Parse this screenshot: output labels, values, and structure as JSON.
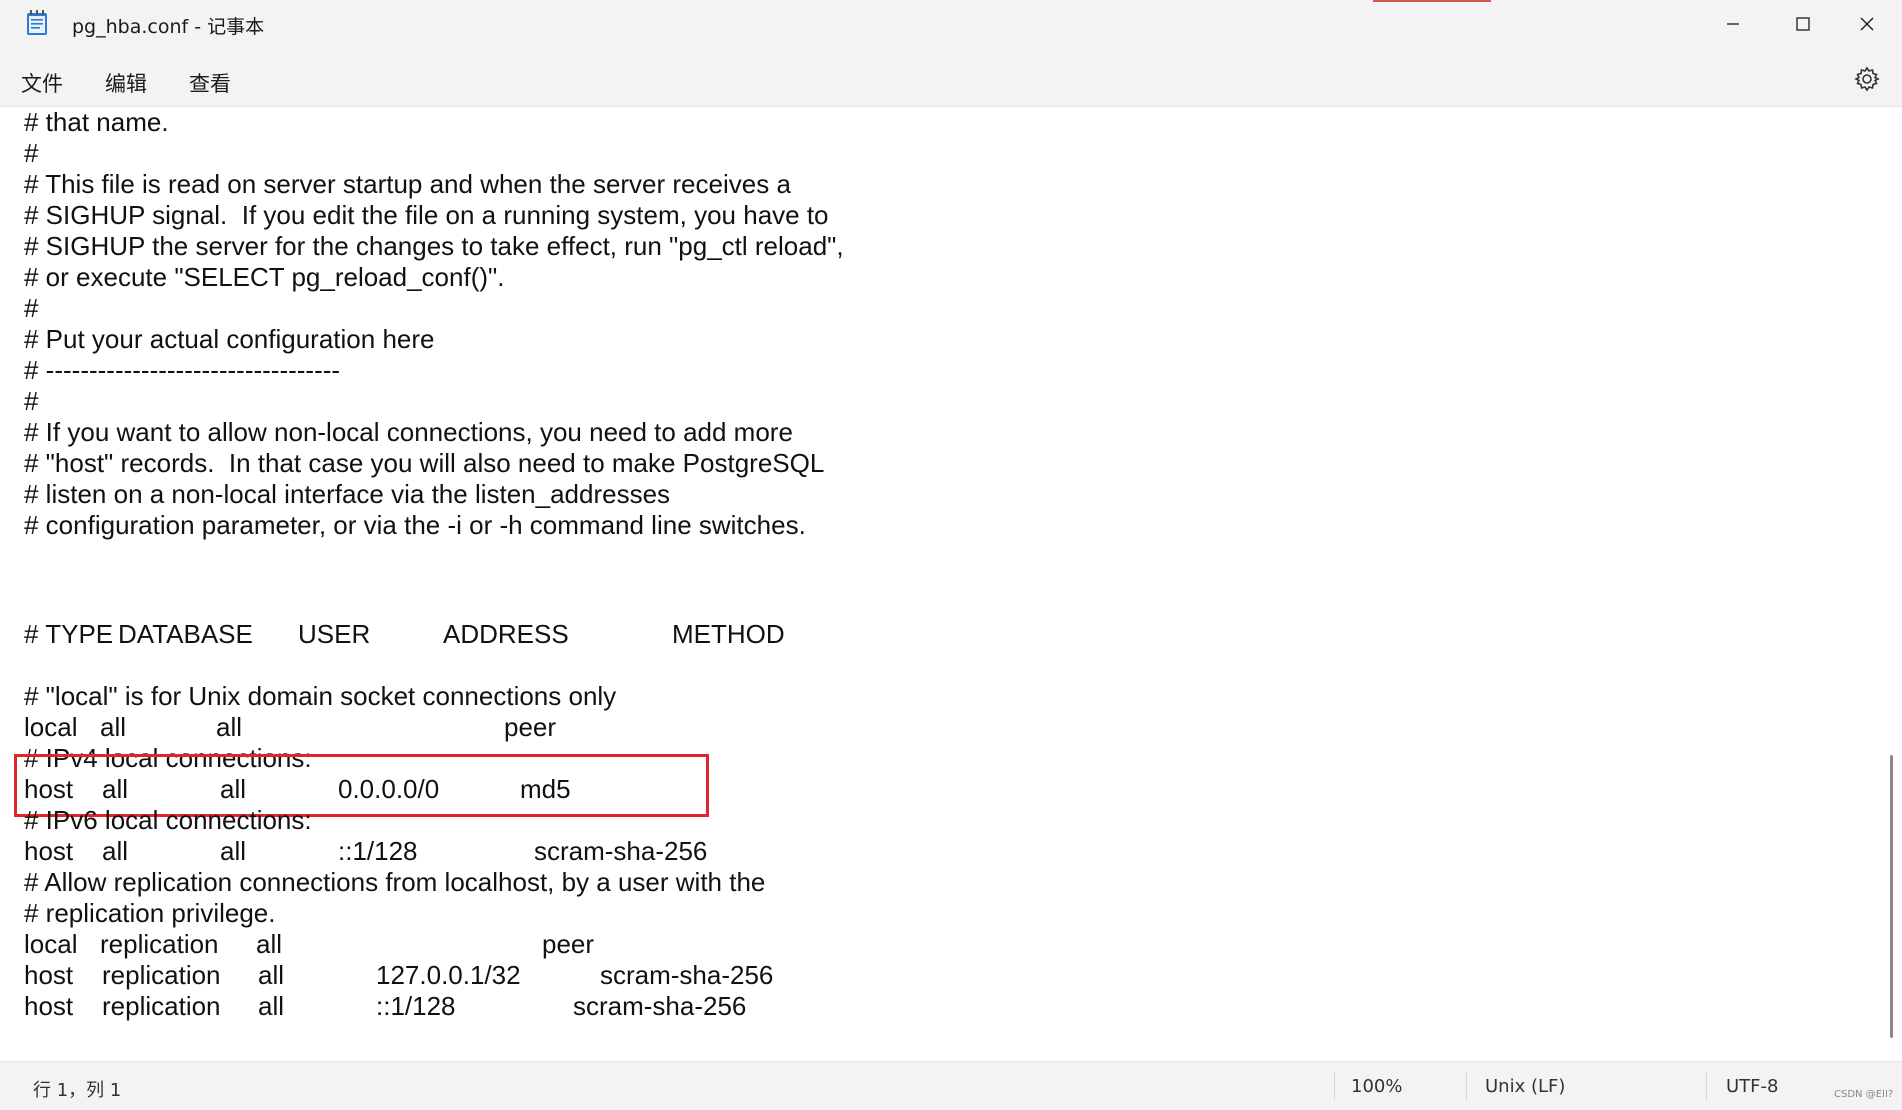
{
  "window": {
    "title": "pg_hba.conf - 记事本",
    "app_icon": "notepad-icon",
    "controls": [
      "minimize-icon",
      "maximize-icon",
      "close-icon"
    ]
  },
  "menu": {
    "file": "文件",
    "edit": "编辑",
    "view": "查看",
    "settings_icon": "gear-icon"
  },
  "editor": {
    "lines": [
      "# that name.",
      "#",
      "# This file is read on server startup and when the server receives a",
      "# SIGHUP signal.  If you edit the file on a running system, you have to",
      "# SIGHUP the server for the changes to take effect, run \"pg_ctl reload\",",
      "# or execute \"SELECT pg_reload_conf()\".",
      "#",
      "# Put your actual configuration here",
      "# ----------------------------------",
      "#",
      "# If you want to allow non-local connections, you need to add more",
      "# \"host\" records.  In that case you will also need to make PostgreSQL",
      "# listen on a non-local interface via the listen_addresses",
      "# configuration parameter, or via the -i or -h command line switches."
    ],
    "header": {
      "prefix": "# TYPE",
      "database": "DATABASE",
      "user": "USER",
      "address": "ADDRESS",
      "method": "METHOD"
    },
    "local_comment": "# \"local\" is for Unix domain socket connections only",
    "ipv4_comment": "# IPv4 local connections:",
    "ipv6_comment": "# IPv6 local connections:",
    "replication_comment_1": "# Allow replication connections from localhost, by a user with the",
    "replication_comment_2": "# replication privilege.",
    "rows": [
      {
        "type": "local",
        "database": "all",
        "user": "all",
        "address": "",
        "method": "peer"
      },
      {
        "type": "host",
        "database": "all",
        "user": "all",
        "address": "0.0.0.0/0",
        "method": "md5"
      },
      {
        "type": "host",
        "database": "all",
        "user": "all",
        "address": "::1/128",
        "method": "scram-sha-256"
      },
      {
        "type": "local",
        "database": "replication",
        "user": "all",
        "address": "",
        "method": "peer"
      },
      {
        "type": "host",
        "database": "replication",
        "user": "all",
        "address": "127.0.0.1/32",
        "method": "scram-sha-256"
      },
      {
        "type": "host",
        "database": "replication",
        "user": "all",
        "address": "::1/128",
        "method": "scram-sha-256"
      }
    ],
    "highlight_color": "#e0252b"
  },
  "status": {
    "position": "行 1，列 1",
    "zoom": "100%",
    "line_ending": "Unix (LF)",
    "encoding": "UTF-8"
  },
  "watermark": "CSDN @EII?"
}
